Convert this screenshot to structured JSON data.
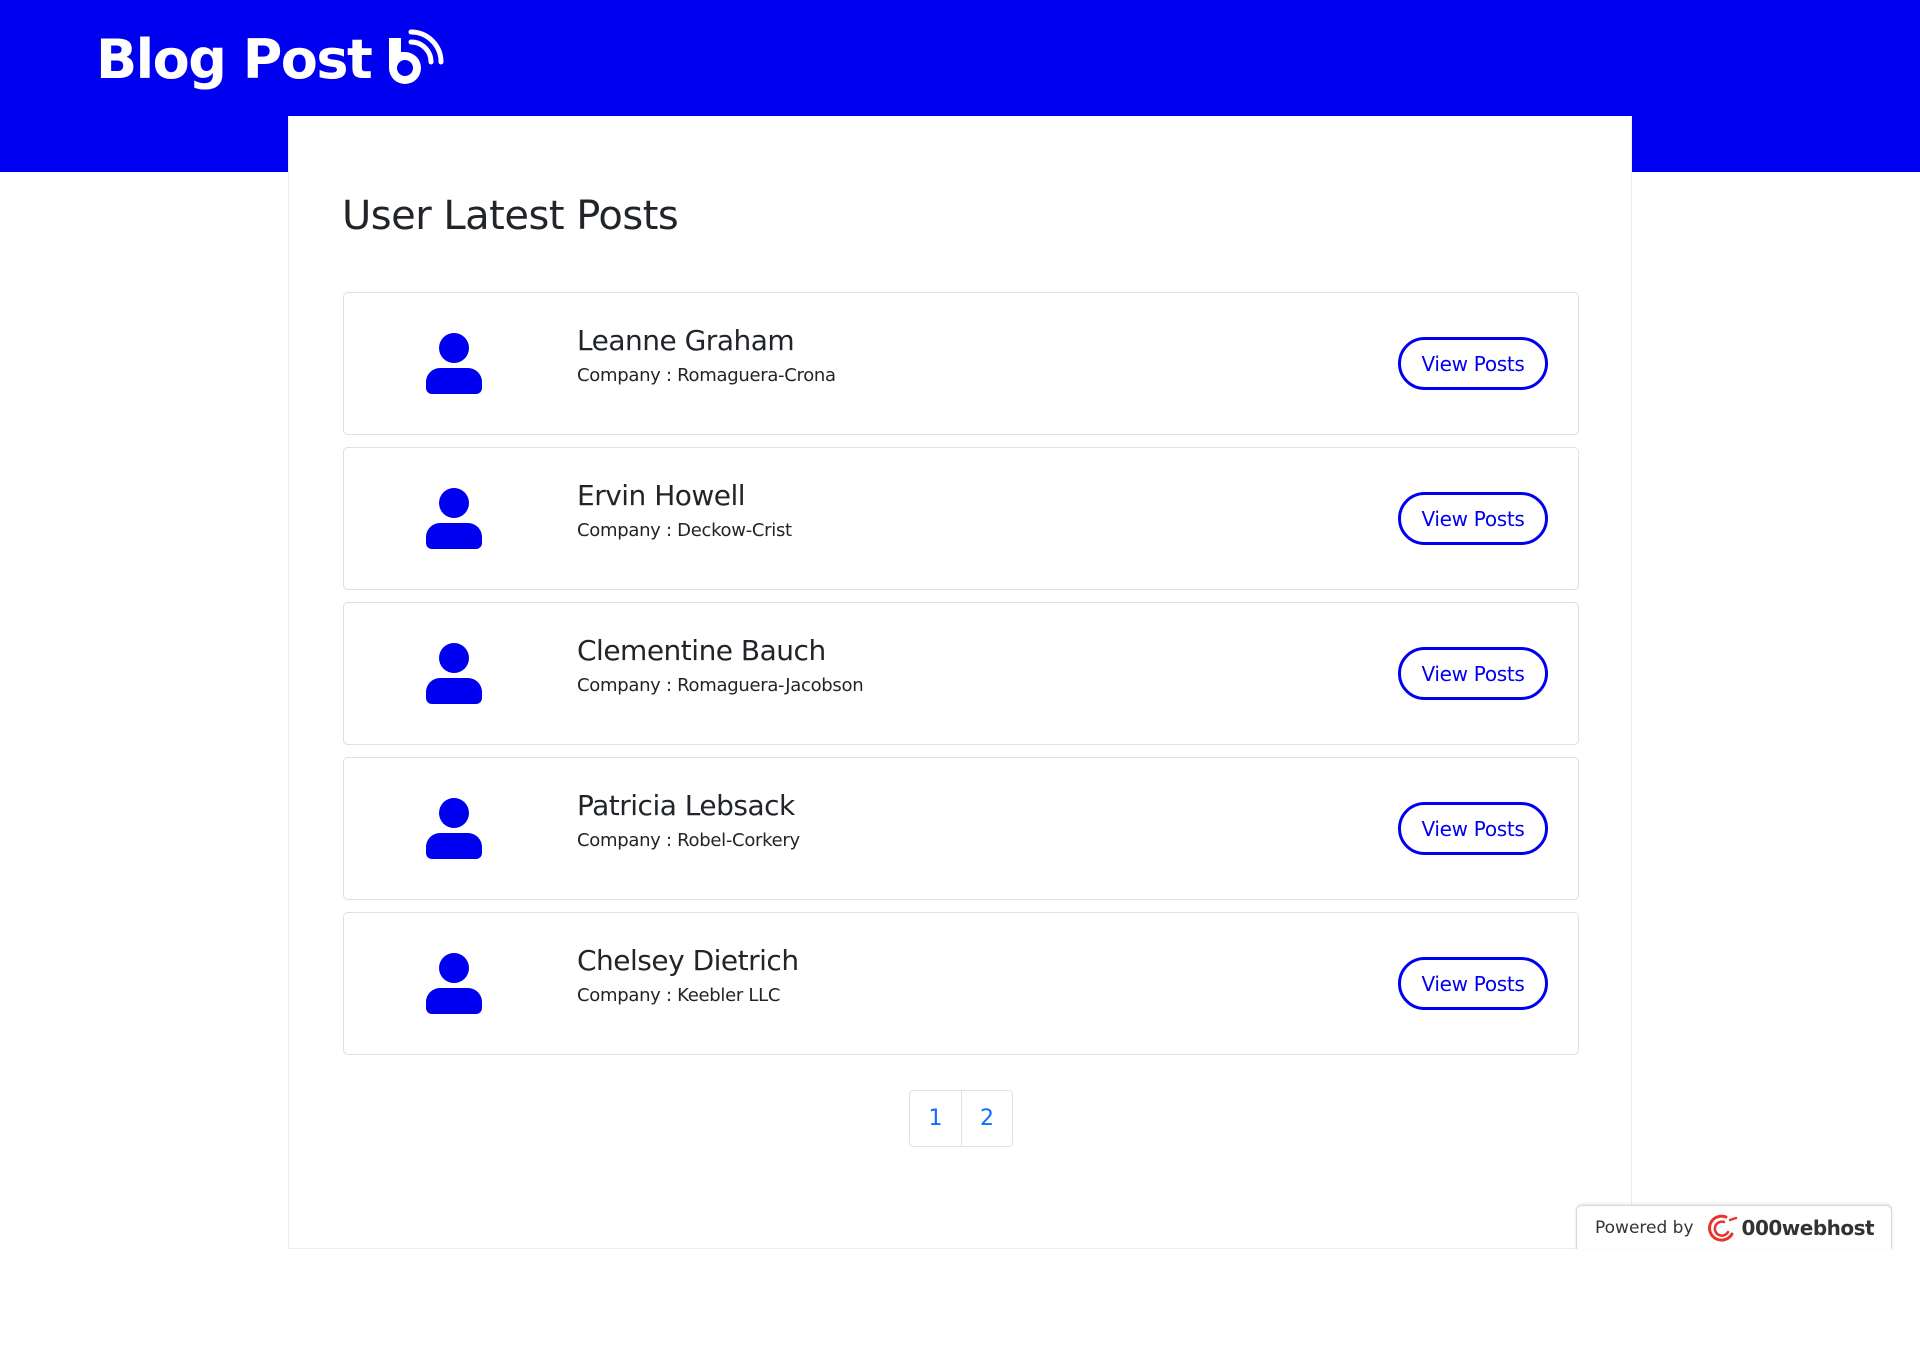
{
  "header": {
    "brand_title": "Blog Post",
    "brand_icon": "blogger-rss-icon",
    "brand_color": "#0000f0"
  },
  "main": {
    "page_title": "User Latest Posts",
    "users": [
      {
        "name": "Leanne Graham",
        "company": "Company : Romaguera-Crona",
        "button_label": "View Posts"
      },
      {
        "name": "Ervin Howell",
        "company": "Company : Deckow-Crist",
        "button_label": "View Posts"
      },
      {
        "name": "Clementine Bauch",
        "company": "Company : Romaguera-Jacobson",
        "button_label": "View Posts"
      },
      {
        "name": "Patricia Lebsack",
        "company": "Company : Robel-Corkery",
        "button_label": "View Posts"
      },
      {
        "name": "Chelsey Dietrich",
        "company": "Company : Keebler LLC",
        "button_label": "View Posts"
      }
    ],
    "pagination": {
      "pages": [
        "1",
        "2"
      ]
    }
  },
  "badge": {
    "powered_by": "Powered by",
    "host_name": "000webhost"
  }
}
